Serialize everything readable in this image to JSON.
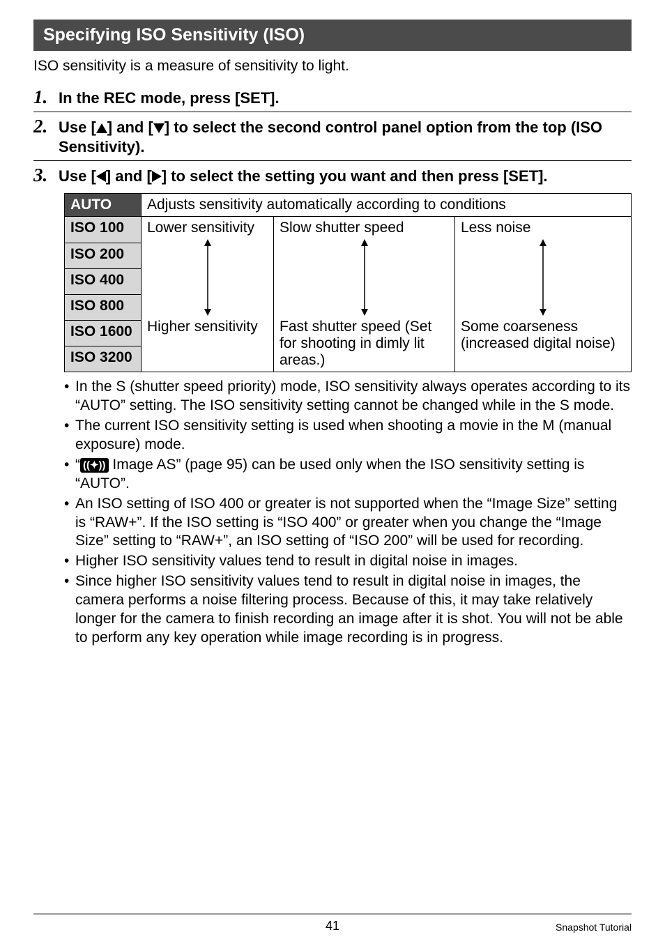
{
  "header": "Specifying ISO Sensitivity (ISO)",
  "intro": "ISO sensitivity is a measure of sensitivity to light.",
  "steps": [
    {
      "num": "1.",
      "pre": "In the REC mode, press [SET]."
    },
    {
      "num": "2.",
      "pre": "Use [",
      "mid": "] and [",
      "post": "] to select the second control panel option from the top (ISO Sensitivity)."
    },
    {
      "num": "3.",
      "pre": "Use [",
      "mid": "] and [",
      "post": "] to select the setting you want and then press [SET]."
    }
  ],
  "table": {
    "auto_label": "AUTO",
    "auto_desc": "Adjusts sensitivity automatically according to conditions",
    "iso100": "ISO 100",
    "iso200": "ISO 200",
    "iso400": "ISO 400",
    "iso800": "ISO 800",
    "iso1600": "ISO 1600",
    "iso3200": "ISO 3200",
    "col1_top": "Lower sensitivity",
    "col1_bot": "Higher sensitivity",
    "col2_top": "Slow shutter speed",
    "col2_bot": "Fast shutter speed (Set for shooting in dimly lit areas.)",
    "col3_top": "Less noise",
    "col3_bot": "Some coarseness (increased digital noise)"
  },
  "notes": {
    "n1": "In the S (shutter speed priority) mode, ISO sensitivity always operates according to its “AUTO” setting. The ISO sensitivity setting cannot be changed while in the S mode.",
    "n2": "The current ISO sensitivity setting is used when shooting a movie in the M (manual exposure) mode.",
    "n3a": "“",
    "n3b": " Image AS” (page 95) can be used only when the ISO sensitivity setting is “AUTO”.",
    "n4": "An ISO setting of ISO 400 or greater is not supported when the “Image Size” setting is “RAW+”. If the ISO setting is “ISO 400” or greater when you change the “Image Size” setting to “RAW+”, an ISO setting of “ISO 200” will be used for recording.",
    "n5": "Higher ISO sensitivity values tend to result in digital noise in images.",
    "n6": "Since higher ISO sensitivity values tend to result in digital noise in images, the camera performs a noise filtering process. Because of this, it may take relatively longer for the camera to finish recording an image after it is shot. You will not be able to perform any key operation while image recording is in progress."
  },
  "footer": {
    "page": "41",
    "section": "Snapshot Tutorial"
  }
}
